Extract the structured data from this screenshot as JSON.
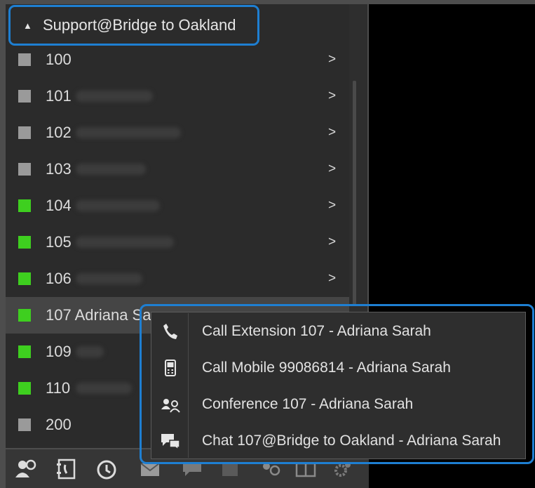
{
  "group": {
    "caret": "▲",
    "name": "Support@Bridge to Oakland"
  },
  "extensions": [
    {
      "ext": "100",
      "name": "",
      "status": "gray",
      "arrow": ">"
    },
    {
      "ext": "101",
      "name": "",
      "status": "gray",
      "arrow": ">"
    },
    {
      "ext": "102",
      "name": "",
      "status": "gray",
      "arrow": ">"
    },
    {
      "ext": "103",
      "name": "",
      "status": "gray",
      "arrow": ">"
    },
    {
      "ext": "104",
      "name": "",
      "status": "green",
      "arrow": ">"
    },
    {
      "ext": "105",
      "name": "",
      "status": "green",
      "arrow": ">"
    },
    {
      "ext": "106",
      "name": "",
      "status": "green",
      "arrow": ">"
    },
    {
      "ext": "107 Adriana Sa",
      "name": "",
      "status": "green",
      "arrow": ""
    },
    {
      "ext": "109",
      "name": "",
      "status": "green",
      "arrow": ""
    },
    {
      "ext": "110",
      "name": "",
      "status": "green",
      "arrow": ""
    },
    {
      "ext": "200",
      "name": "",
      "status": "gray",
      "arrow": ""
    }
  ],
  "context_menu": {
    "items": [
      {
        "icon": "phone-icon",
        "label": "Call Extension 107 - Adriana Sarah"
      },
      {
        "icon": "mobile-phone-icon",
        "label": "Call Mobile 99086814 - Adriana Sarah"
      },
      {
        "icon": "conference-icon",
        "label": "Conference 107 - Adriana Sarah"
      },
      {
        "icon": "chat-icon",
        "label": "Chat 107@Bridge to Oakland - Adriana Sarah"
      }
    ]
  },
  "toolbar": {
    "icons": [
      "contacts-icon",
      "phonebook-icon",
      "history-icon",
      "mail-icon",
      "chat-icon",
      "queue-icon",
      "conference-icon",
      "layout-icon",
      "settings-icon"
    ]
  },
  "colors": {
    "accent": "#1e7fd2",
    "online": "#3ecf1f",
    "offline": "#9a9a9a"
  }
}
